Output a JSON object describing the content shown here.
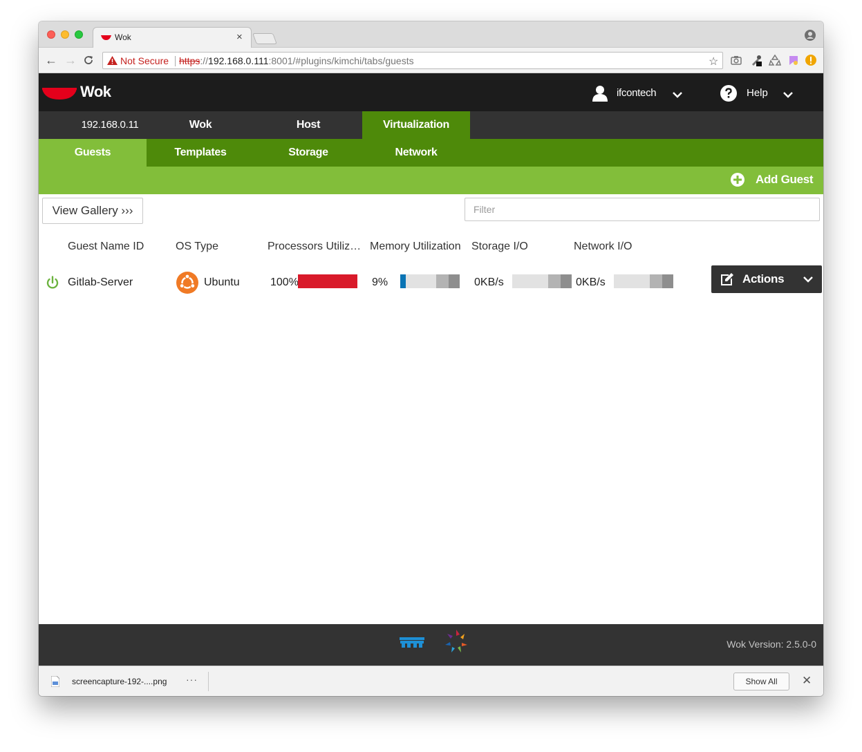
{
  "browser": {
    "tab_title": "Wok",
    "tab_close": "×",
    "nav": {
      "back": "←",
      "forward": "→",
      "reload": "C"
    },
    "security_label": "Not Secure",
    "url_scheme": "https",
    "url_sep": "://",
    "url_host": "192.168.0.111",
    "url_rest": ":8001/#plugins/kimchi/tabs/guests",
    "bookmark_star": "☆"
  },
  "app": {
    "logo_text": "Wok",
    "user_name": "ifcontech",
    "help_label": "Help"
  },
  "top_nav": [
    {
      "label": "192.168.0.11"
    },
    {
      "label": "Wok"
    },
    {
      "label": "Host"
    },
    {
      "label": "Virtualization"
    }
  ],
  "sub_nav": [
    {
      "label": "Guests"
    },
    {
      "label": "Templates"
    },
    {
      "label": "Storage"
    },
    {
      "label": "Network"
    }
  ],
  "toolbar": {
    "add_guest_label": "Add Guest"
  },
  "content": {
    "gallery_button": "View Gallery ›››",
    "filter_placeholder": "Filter",
    "columns": [
      "Guest Name ID",
      "OS Type",
      "Processors Utiliz…",
      "Memory Utilization",
      "Storage I/O",
      "Network I/O"
    ],
    "guest": {
      "name": "Gitlab-Server",
      "os": "Ubuntu",
      "cpu": "100%",
      "cpu_fraction": 1.0,
      "memory": "9%",
      "memory_fraction": 0.09,
      "storage": "0KB/s",
      "network": "0KB/s"
    },
    "actions_label": "Actions"
  },
  "footer": {
    "version": "Wok Version: 2.5.0-0"
  },
  "downloads": {
    "file_name": "screencapture-192-....png",
    "more": "···",
    "show_all": "Show All",
    "close": "✕"
  },
  "colors": {
    "header_bg": "#1c1c1c",
    "nav_bg": "#333333",
    "accent_dark_green": "#4e8a0a",
    "accent_light_green": "#82be3a",
    "cpu_bar": "#d91a2a",
    "memory_bar": "#0a74b4",
    "logo_red": "#e4001b"
  }
}
